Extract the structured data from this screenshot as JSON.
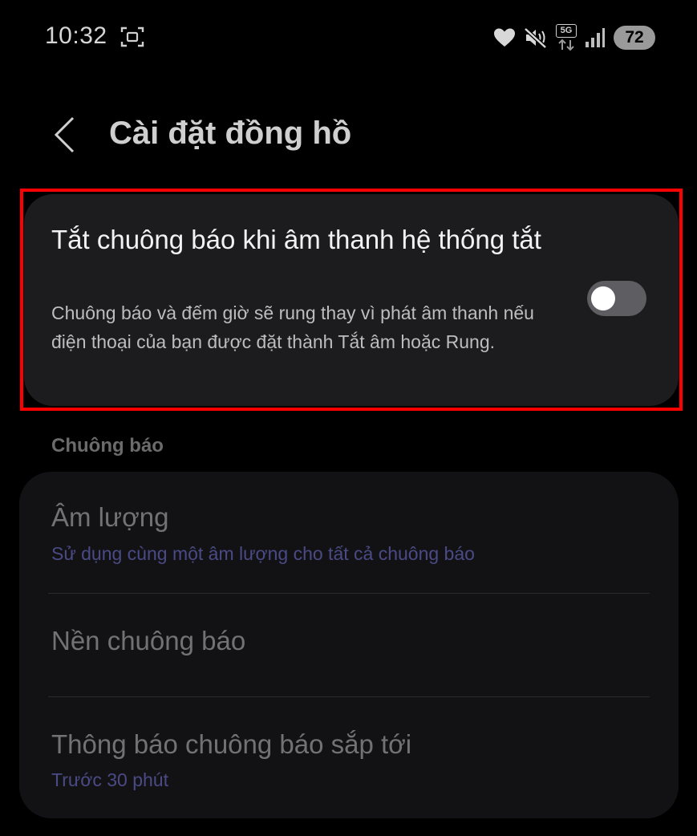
{
  "status_bar": {
    "time": "10:32",
    "network": "5G",
    "battery": "72"
  },
  "header": {
    "title": "Cài đặt đồng hồ"
  },
  "silence_setting": {
    "title": "Tắt chuông báo khi âm thanh hệ thống tắt",
    "description": "Chuông báo và đếm giờ sẽ rung thay vì phát âm thanh nếu điện thoại của bạn được đặt thành Tắt âm hoặc Rung.",
    "enabled": false
  },
  "alarm_section": {
    "label": "Chuông báo",
    "items": [
      {
        "title": "Âm lượng",
        "subtitle": "Sử dụng cùng một âm lượng cho tất cả chuông báo"
      },
      {
        "title": "Nền chuông báo",
        "subtitle": ""
      },
      {
        "title": "Thông báo chuông báo sắp tới",
        "subtitle": "Trước 30 phút"
      }
    ]
  },
  "colors": {
    "background": "#000000",
    "card": "#1c1c1e",
    "accent_subtitle": "#4a4a86",
    "highlight": "#ff0000"
  },
  "icons": [
    "screenshot-icon",
    "heart-icon",
    "mute-icon",
    "signal-icon",
    "back-chevron-icon"
  ]
}
